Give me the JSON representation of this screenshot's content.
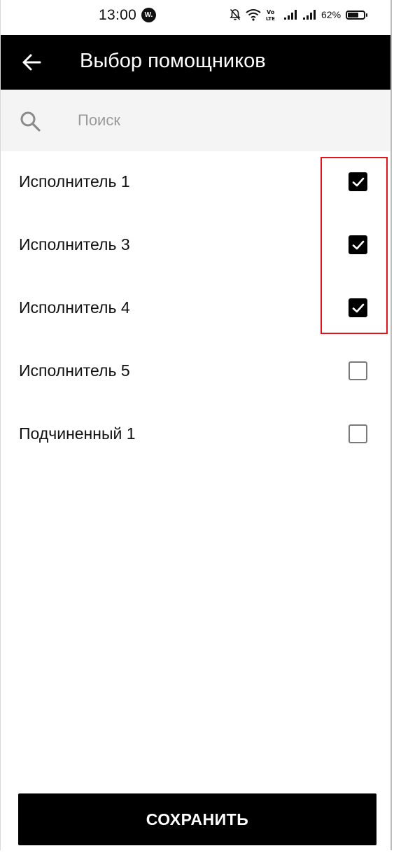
{
  "status_bar": {
    "time": "13:00",
    "app_badge": "W.",
    "battery_percent": "62%",
    "icons": [
      "mute-icon",
      "wifi-icon",
      "volte-icon",
      "signal-icon",
      "signal-icon",
      "battery-icon"
    ]
  },
  "header": {
    "title": "Выбор помощников",
    "back_icon": "arrow-left-icon"
  },
  "search": {
    "placeholder": "Поиск",
    "value": "",
    "icon": "search-icon"
  },
  "assistants": [
    {
      "label": "Исполнитель 1",
      "checked": true
    },
    {
      "label": "Исполнитель 3",
      "checked": true
    },
    {
      "label": "Исполнитель 4",
      "checked": true
    },
    {
      "label": "Исполнитель 5",
      "checked": false
    },
    {
      "label": "Подчиненный 1",
      "checked": false
    }
  ],
  "actions": {
    "save_label": "СОХРАНИТЬ"
  },
  "colors": {
    "app_bar": "#000000",
    "search_background": "#f4f4f4",
    "highlight": "#e0151c",
    "button": "#000000"
  }
}
